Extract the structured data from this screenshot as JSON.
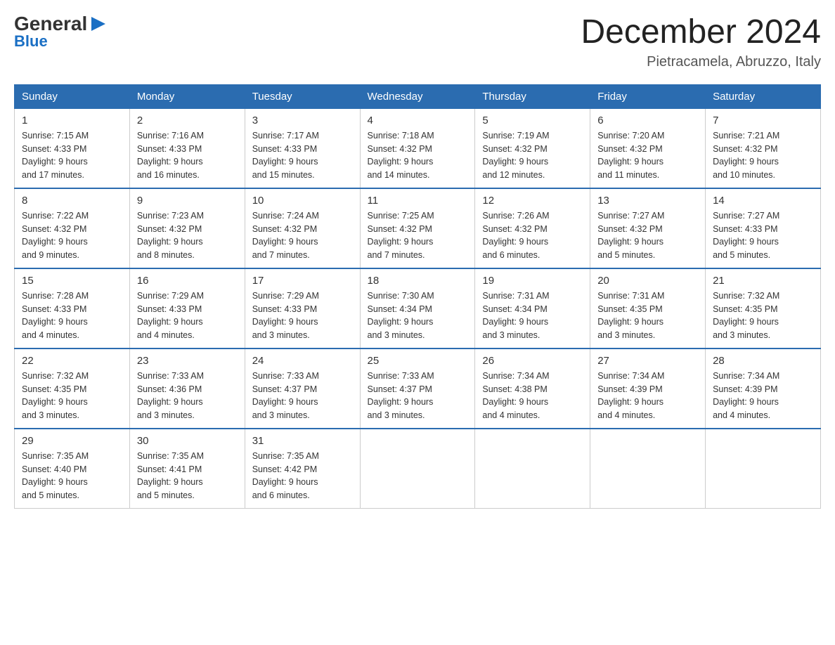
{
  "logo": {
    "general": "General",
    "blue": "Blue"
  },
  "title": "December 2024",
  "location": "Pietracamela, Abruzzo, Italy",
  "days_of_week": [
    "Sunday",
    "Monday",
    "Tuesday",
    "Wednesday",
    "Thursday",
    "Friday",
    "Saturday"
  ],
  "weeks": [
    [
      {
        "day": "1",
        "sunrise": "7:15 AM",
        "sunset": "4:33 PM",
        "daylight": "9 hours and 17 minutes."
      },
      {
        "day": "2",
        "sunrise": "7:16 AM",
        "sunset": "4:33 PM",
        "daylight": "9 hours and 16 minutes."
      },
      {
        "day": "3",
        "sunrise": "7:17 AM",
        "sunset": "4:33 PM",
        "daylight": "9 hours and 15 minutes."
      },
      {
        "day": "4",
        "sunrise": "7:18 AM",
        "sunset": "4:32 PM",
        "daylight": "9 hours and 14 minutes."
      },
      {
        "day": "5",
        "sunrise": "7:19 AM",
        "sunset": "4:32 PM",
        "daylight": "9 hours and 12 minutes."
      },
      {
        "day": "6",
        "sunrise": "7:20 AM",
        "sunset": "4:32 PM",
        "daylight": "9 hours and 11 minutes."
      },
      {
        "day": "7",
        "sunrise": "7:21 AM",
        "sunset": "4:32 PM",
        "daylight": "9 hours and 10 minutes."
      }
    ],
    [
      {
        "day": "8",
        "sunrise": "7:22 AM",
        "sunset": "4:32 PM",
        "daylight": "9 hours and 9 minutes."
      },
      {
        "day": "9",
        "sunrise": "7:23 AM",
        "sunset": "4:32 PM",
        "daylight": "9 hours and 8 minutes."
      },
      {
        "day": "10",
        "sunrise": "7:24 AM",
        "sunset": "4:32 PM",
        "daylight": "9 hours and 7 minutes."
      },
      {
        "day": "11",
        "sunrise": "7:25 AM",
        "sunset": "4:32 PM",
        "daylight": "9 hours and 7 minutes."
      },
      {
        "day": "12",
        "sunrise": "7:26 AM",
        "sunset": "4:32 PM",
        "daylight": "9 hours and 6 minutes."
      },
      {
        "day": "13",
        "sunrise": "7:27 AM",
        "sunset": "4:32 PM",
        "daylight": "9 hours and 5 minutes."
      },
      {
        "day": "14",
        "sunrise": "7:27 AM",
        "sunset": "4:33 PM",
        "daylight": "9 hours and 5 minutes."
      }
    ],
    [
      {
        "day": "15",
        "sunrise": "7:28 AM",
        "sunset": "4:33 PM",
        "daylight": "9 hours and 4 minutes."
      },
      {
        "day": "16",
        "sunrise": "7:29 AM",
        "sunset": "4:33 PM",
        "daylight": "9 hours and 4 minutes."
      },
      {
        "day": "17",
        "sunrise": "7:29 AM",
        "sunset": "4:33 PM",
        "daylight": "9 hours and 3 minutes."
      },
      {
        "day": "18",
        "sunrise": "7:30 AM",
        "sunset": "4:34 PM",
        "daylight": "9 hours and 3 minutes."
      },
      {
        "day": "19",
        "sunrise": "7:31 AM",
        "sunset": "4:34 PM",
        "daylight": "9 hours and 3 minutes."
      },
      {
        "day": "20",
        "sunrise": "7:31 AM",
        "sunset": "4:35 PM",
        "daylight": "9 hours and 3 minutes."
      },
      {
        "day": "21",
        "sunrise": "7:32 AM",
        "sunset": "4:35 PM",
        "daylight": "9 hours and 3 minutes."
      }
    ],
    [
      {
        "day": "22",
        "sunrise": "7:32 AM",
        "sunset": "4:35 PM",
        "daylight": "9 hours and 3 minutes."
      },
      {
        "day": "23",
        "sunrise": "7:33 AM",
        "sunset": "4:36 PM",
        "daylight": "9 hours and 3 minutes."
      },
      {
        "day": "24",
        "sunrise": "7:33 AM",
        "sunset": "4:37 PM",
        "daylight": "9 hours and 3 minutes."
      },
      {
        "day": "25",
        "sunrise": "7:33 AM",
        "sunset": "4:37 PM",
        "daylight": "9 hours and 3 minutes."
      },
      {
        "day": "26",
        "sunrise": "7:34 AM",
        "sunset": "4:38 PM",
        "daylight": "9 hours and 4 minutes."
      },
      {
        "day": "27",
        "sunrise": "7:34 AM",
        "sunset": "4:39 PM",
        "daylight": "9 hours and 4 minutes."
      },
      {
        "day": "28",
        "sunrise": "7:34 AM",
        "sunset": "4:39 PM",
        "daylight": "9 hours and 4 minutes."
      }
    ],
    [
      {
        "day": "29",
        "sunrise": "7:35 AM",
        "sunset": "4:40 PM",
        "daylight": "9 hours and 5 minutes."
      },
      {
        "day": "30",
        "sunrise": "7:35 AM",
        "sunset": "4:41 PM",
        "daylight": "9 hours and 5 minutes."
      },
      {
        "day": "31",
        "sunrise": "7:35 AM",
        "sunset": "4:42 PM",
        "daylight": "9 hours and 6 minutes."
      },
      null,
      null,
      null,
      null
    ]
  ],
  "labels": {
    "sunrise": "Sunrise:",
    "sunset": "Sunset:",
    "daylight": "Daylight:"
  }
}
